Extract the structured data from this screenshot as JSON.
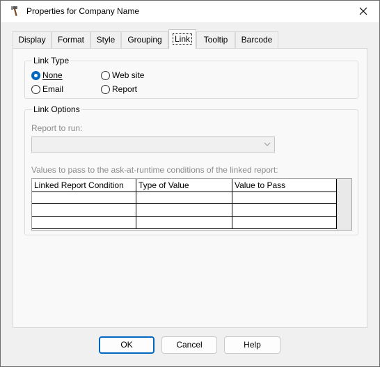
{
  "window": {
    "title": "Properties for Company Name"
  },
  "tabs": [
    {
      "label": "Display"
    },
    {
      "label": "Format"
    },
    {
      "label": "Style"
    },
    {
      "label": "Grouping"
    },
    {
      "label": "Link",
      "selected": true
    },
    {
      "label": "Tooltip"
    },
    {
      "label": "Barcode"
    }
  ],
  "link_type": {
    "group_label": "Link Type",
    "options": [
      {
        "label": "None",
        "checked": true
      },
      {
        "label": "Web site",
        "checked": false
      },
      {
        "label": "Email",
        "checked": false
      },
      {
        "label": "Report",
        "checked": false
      }
    ]
  },
  "link_options": {
    "group_label": "Link Options",
    "report_to_run_label": "Report to run:",
    "report_to_run_value": "",
    "values_label": "Values to pass to the ask-at-runtime conditions of the linked report:",
    "columns": [
      "Linked Report Condition",
      "Type of Value",
      "Value to Pass"
    ],
    "rows": [
      [
        "",
        "",
        ""
      ],
      [
        "",
        "",
        ""
      ],
      [
        "",
        "",
        ""
      ]
    ]
  },
  "buttons": {
    "ok": "OK",
    "cancel": "Cancel",
    "help": "Help"
  },
  "colors": {
    "accent": "#0067c0",
    "disabled_text": "#8c8c8c"
  }
}
